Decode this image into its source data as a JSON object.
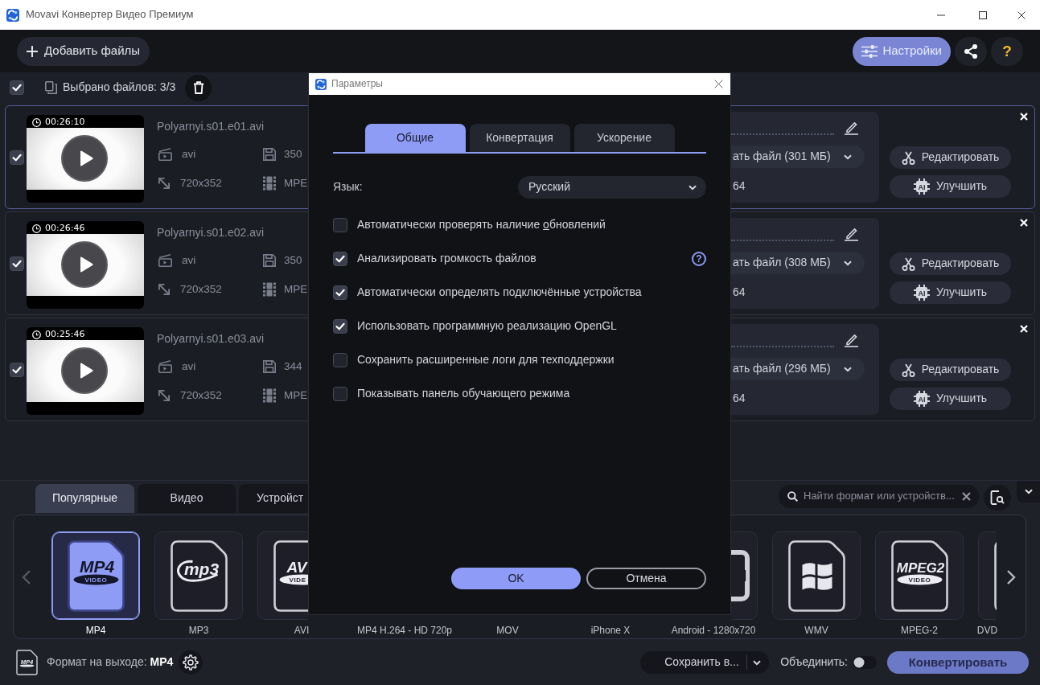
{
  "window": {
    "title": "Movavi Конвертер Видео Премиум"
  },
  "toolbar": {
    "add_files": "Добавить файлы",
    "settings": "Настройки",
    "help": "?"
  },
  "selection": {
    "checked": true,
    "label": "Выбрано файлов: 3/3"
  },
  "files": [
    {
      "checked": true,
      "selected": true,
      "duration": "00:26:10",
      "name": "Polyarnyi.s01.e01.avi",
      "container": "avi",
      "size": "350",
      "resolution": "720x352",
      "codec": "MPE",
      "output_size": "ать файл (301 МБ)",
      "output_codec": "64",
      "edit": "Редактировать",
      "enhance_badge": "AI",
      "enhance": "Улучшить"
    },
    {
      "checked": true,
      "selected": false,
      "duration": "00:26:46",
      "name": "Polyarnyi.s01.e02.avi",
      "container": "avi",
      "size": "350",
      "resolution": "720x352",
      "codec": "MPE",
      "output_size": "ать файл (308 МБ)",
      "output_codec": "64",
      "edit": "Редактировать",
      "enhance_badge": "AI",
      "enhance": "Улучшить"
    },
    {
      "checked": true,
      "selected": false,
      "duration": "00:25:46",
      "name": "Polyarnyi.s01.e03.avi",
      "container": "avi",
      "size": "344",
      "resolution": "720x352",
      "codec": "MPE",
      "output_size": "ать файл (296 МБ)",
      "output_codec": "64",
      "edit": "Редактировать",
      "enhance_badge": "AI",
      "enhance": "Улучшить"
    }
  ],
  "formats": {
    "tabs": [
      {
        "label": "Популярные",
        "selected": true
      },
      {
        "label": "Видео",
        "selected": false
      },
      {
        "label": "Устройст",
        "selected": false
      }
    ],
    "search": {
      "placeholder": "Найти формат или устройств..."
    },
    "items": [
      {
        "label": "MP4",
        "selected": true,
        "kind": "video-doc",
        "logo": "MP4",
        "logo_sub": "VIDEO"
      },
      {
        "label": "MP3",
        "selected": false,
        "kind": "audio-doc",
        "logo": "mp3"
      },
      {
        "label": "AVI",
        "selected": false,
        "kind": "video-doc",
        "logo": "AV",
        "logo_sub": "VIDE"
      },
      {
        "label": "MP4 H.264 - HD 720p",
        "selected": false
      },
      {
        "label": "MOV",
        "selected": false
      },
      {
        "label": "iPhone X",
        "selected": false
      },
      {
        "label": "Android - 1280x720",
        "selected": false,
        "kind": "device"
      },
      {
        "label": "WMV",
        "selected": false,
        "kind": "flag-doc"
      },
      {
        "label": "MPEG-2",
        "selected": false,
        "kind": "video-doc",
        "logo": "MPEG2",
        "logo_sub": "VIDEO"
      },
      {
        "label": "DVD",
        "selected": false,
        "kind": "doc"
      }
    ]
  },
  "footer": {
    "icon_logo": "MP4",
    "output_format": "Формат на выходе: **MP4**",
    "save_to": "Сохранить в...",
    "merge": {
      "label": "Объединить:",
      "on": false
    },
    "convert": "Конвертировать"
  },
  "dialog": {
    "title": "Параметры",
    "tabs": [
      {
        "label": "Общие",
        "selected": true
      },
      {
        "label": "Конвертация",
        "selected": false
      },
      {
        "label": "Ускорение",
        "selected": false
      }
    ],
    "language": {
      "label": "Язык:",
      "value": "Русский"
    },
    "options": [
      {
        "checked": false,
        "label_before": "Автоматически проверять наличие ",
        "label_underlined": "о",
        "label_after": "бновлений"
      },
      {
        "checked": true,
        "help": "?",
        "label": "Анализировать громкость файлов"
      },
      {
        "checked": true,
        "label": "Автоматически определять подключённые устройства"
      },
      {
        "checked": true,
        "label": "Использовать программную реализацию OpenGL"
      },
      {
        "checked": false,
        "label": "Сохранить расширенные логи для техподдержки"
      },
      {
        "checked": false,
        "label": "Показывать панель обучающего режима"
      }
    ],
    "ok": "OK",
    "cancel": "Отмена"
  }
}
